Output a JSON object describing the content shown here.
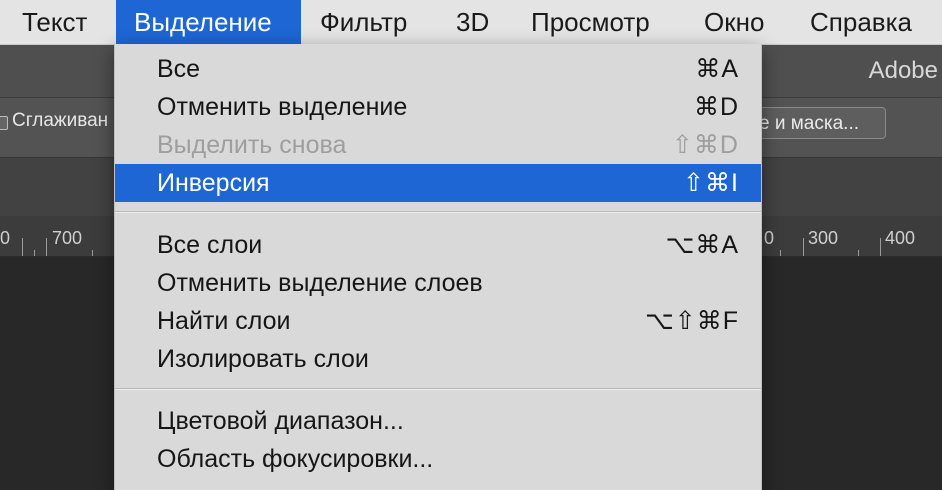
{
  "menubar": {
    "items": [
      "Текст",
      "Выделение",
      "Фильтр",
      "3D",
      "Просмотр",
      "Окно",
      "Справка"
    ],
    "active_index": 1
  },
  "titlebar": {
    "app_name": "Adobe"
  },
  "options": {
    "smoothing_label": "Сглаживан",
    "mask_button_label": "е и маска..."
  },
  "ruler": {
    "labels": [
      "0",
      "700",
      "0",
      "300",
      "400"
    ]
  },
  "dropdown": {
    "items": [
      {
        "label": "Все",
        "shortcut": "⌘A",
        "disabled": false,
        "highlight": false
      },
      {
        "label": "Отменить выделение",
        "shortcut": "⌘D",
        "disabled": false,
        "highlight": false
      },
      {
        "label": "Выделить снова",
        "shortcut": "⇧⌘D",
        "disabled": true,
        "highlight": false
      },
      {
        "label": "Инверсия",
        "shortcut": "⇧⌘I",
        "disabled": false,
        "highlight": true
      },
      {
        "label": "Все слои",
        "shortcut": "⌥⌘A",
        "disabled": false,
        "highlight": false
      },
      {
        "label": "Отменить выделение слоев",
        "shortcut": "",
        "disabled": false,
        "highlight": false
      },
      {
        "label": "Найти слои",
        "shortcut": "⌥⇧⌘F",
        "disabled": false,
        "highlight": false
      },
      {
        "label": "Изолировать слои",
        "shortcut": "",
        "disabled": false,
        "highlight": false
      },
      {
        "label": "Цветовой диапазон...",
        "shortcut": "",
        "disabled": false,
        "highlight": false
      },
      {
        "label": "Область фокусировки...",
        "shortcut": "",
        "disabled": false,
        "highlight": false
      }
    ]
  },
  "colors": {
    "highlight": "#1d66d4",
    "menu_bg": "#d9d9d9",
    "disabled_text": "#9e9e9e"
  }
}
